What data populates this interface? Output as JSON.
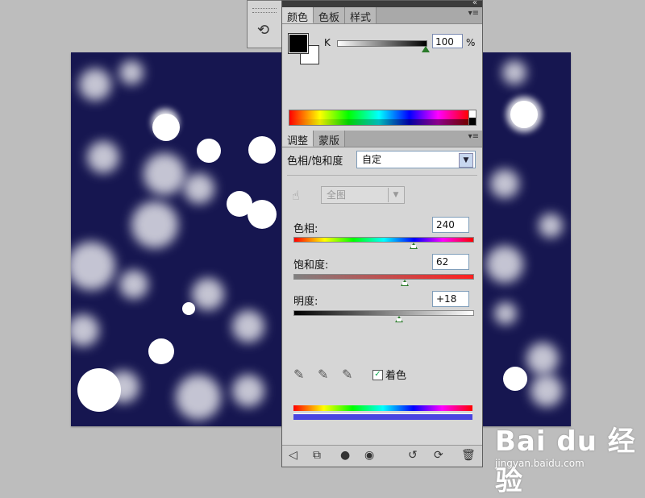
{
  "color_panel": {
    "tabs": [
      "颜色",
      "色板",
      "样式"
    ],
    "channel_label": "K",
    "k_value": "100",
    "k_unit": "%",
    "k_level": 1.0
  },
  "adjustments_panel": {
    "tabs": [
      "调整",
      "蒙版"
    ],
    "title": "色相/饱和度",
    "preset_value": "自定",
    "range_value": "全图",
    "hue": {
      "label": "色相:",
      "value": "240",
      "level": 0.67
    },
    "saturation": {
      "label": "饱和度:",
      "value": "62",
      "level": 0.62
    },
    "lightness": {
      "label": "明度:",
      "value": "+18",
      "level": 0.59
    },
    "colorize_label": "着色",
    "colorize_checked": true
  },
  "watermark": {
    "logo_text": "Bai du 经验",
    "url": "jingyan.baidu.com"
  },
  "icons": {
    "history": "history-icon",
    "panel_menu": "panel-menu-icon",
    "eyedroppers": [
      "eyedropper-icon",
      "eyedropper-plus-icon",
      "eyedropper-minus-icon"
    ],
    "footer": [
      "back-icon",
      "clip-layer-icon",
      "mask-icon",
      "visibility-icon",
      "view-previous-icon",
      "reset-icon",
      "delete-icon"
    ]
  },
  "colors": {
    "canvas_background": "#161650",
    "slider_thumb": "#2a7a2a",
    "colorized_bar": "#4a45e0"
  }
}
